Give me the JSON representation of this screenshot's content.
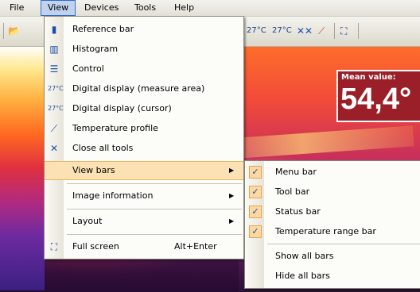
{
  "menubar": {
    "items": [
      "File",
      "View",
      "Devices",
      "Tools",
      "Help"
    ],
    "active": "View"
  },
  "toolbar": {
    "icons": [
      "open-icon",
      "save-icon",
      "digital-display-area-icon",
      "digital-display-cursor-icon",
      "close-tools-icon",
      "temperature-profile-icon",
      "full-screen-icon"
    ],
    "glyphs": {
      "area": "27°C",
      "cursor": "27°C"
    }
  },
  "overlay": {
    "mean_label": "Mean value:",
    "mean_value": "54,4°"
  },
  "view_menu": {
    "items": [
      {
        "label": "Reference bar",
        "icon": "reference-bar-icon"
      },
      {
        "label": "Histogram",
        "icon": "histogram-icon"
      },
      {
        "label": "Control",
        "icon": "control-icon"
      },
      {
        "label": "Digital display (measure area)",
        "icon": "digital-display-area-icon"
      },
      {
        "label": "Digital display (cursor)",
        "icon": "digital-display-cursor-icon"
      },
      {
        "label": "Temperature profile",
        "icon": "temperature-profile-icon"
      },
      {
        "label": "Close all tools",
        "icon": "close-tools-icon"
      },
      {
        "label": "View bars",
        "submenu": true,
        "highlighted": true
      },
      {
        "label": "Image information",
        "submenu": true
      },
      {
        "label": "Layout",
        "submenu": true
      },
      {
        "label": "Full screen",
        "shortcut": "Alt+Enter",
        "icon": "full-screen-icon"
      }
    ]
  },
  "view_bars_submenu": {
    "items": [
      {
        "label": "Menu bar",
        "checked": true
      },
      {
        "label": "Tool bar",
        "checked": true
      },
      {
        "label": "Status bar",
        "checked": true
      },
      {
        "label": "Temperature range bar",
        "checked": true
      },
      {
        "label": "Show all bars",
        "checked": false
      },
      {
        "label": "Hide all bars",
        "checked": false
      }
    ]
  },
  "colors": {
    "highlight": "#fbe1b3",
    "mean_box": "#9a1f28",
    "check_bg": "#fbd9a0"
  }
}
